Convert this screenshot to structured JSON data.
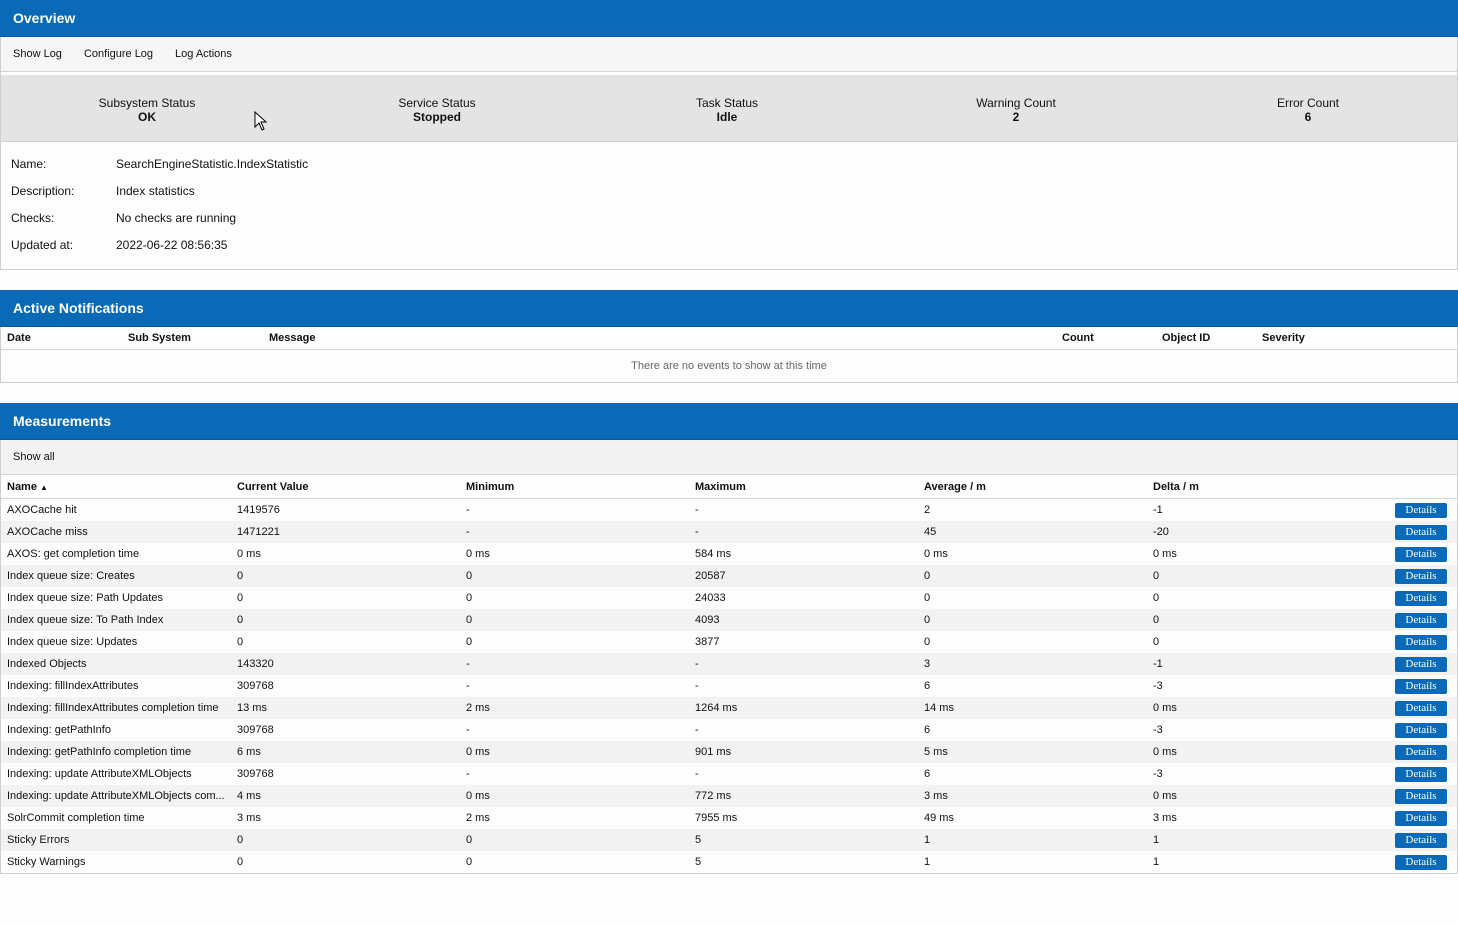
{
  "overview": {
    "title": "Overview",
    "toolbar": [
      "Show Log",
      "Configure Log",
      "Log Actions"
    ],
    "status": [
      {
        "label": "Subsystem Status",
        "value": "OK"
      },
      {
        "label": "Service Status",
        "value": "Stopped"
      },
      {
        "label": "Task Status",
        "value": "Idle"
      },
      {
        "label": "Warning Count",
        "value": "2"
      },
      {
        "label": "Error Count",
        "value": "6"
      }
    ],
    "info": [
      {
        "label": "Name:",
        "value": "SearchEngineStatistic.IndexStatistic"
      },
      {
        "label": "Description:",
        "value": "Index statistics"
      },
      {
        "label": "Checks:",
        "value": "No checks are running"
      },
      {
        "label": "Updated at:",
        "value": "2022-06-22 08:56:35"
      }
    ]
  },
  "notifications": {
    "title": "Active Notifications",
    "columns": [
      "Date",
      "Sub System",
      "Message",
      "Count",
      "Object ID",
      "Severity"
    ],
    "empty_text": "There are no events to show at this time"
  },
  "measurements": {
    "title": "Measurements",
    "show_all": "Show all",
    "columns": [
      "Name",
      "Current Value",
      "Minimum",
      "Maximum",
      "Average / m",
      "Delta / m"
    ],
    "sort_icon": "sort-up-icon",
    "details_label": "Details",
    "rows": [
      [
        "AXOCache hit",
        "1419576",
        "-",
        "-",
        "2",
        "-1"
      ],
      [
        "AXOCache miss",
        "1471221",
        "-",
        "-",
        "45",
        "-20"
      ],
      [
        "AXOS: get completion time",
        "0 ms",
        "0 ms",
        "584 ms",
        "0 ms",
        "0 ms"
      ],
      [
        "Index queue size: Creates",
        "0",
        "0",
        "20587",
        "0",
        "0"
      ],
      [
        "Index queue size: Path Updates",
        "0",
        "0",
        "24033",
        "0",
        "0"
      ],
      [
        "Index queue size: To Path Index",
        "0",
        "0",
        "4093",
        "0",
        "0"
      ],
      [
        "Index queue size: Updates",
        "0",
        "0",
        "3877",
        "0",
        "0"
      ],
      [
        "Indexed Objects",
        "143320",
        "-",
        "-",
        "3",
        "-1"
      ],
      [
        "Indexing: fillIndexAttributes",
        "309768",
        "-",
        "-",
        "6",
        "-3"
      ],
      [
        "Indexing: fillIndexAttributes completion time",
        "13 ms",
        "2 ms",
        "1264 ms",
        "14 ms",
        "0 ms"
      ],
      [
        "Indexing: getPathInfo",
        "309768",
        "-",
        "-",
        "6",
        "-3"
      ],
      [
        "Indexing: getPathInfo completion time",
        "6 ms",
        "0 ms",
        "901 ms",
        "5 ms",
        "0 ms"
      ],
      [
        "Indexing: update AttributeXMLObjects",
        "309768",
        "-",
        "-",
        "6",
        "-3"
      ],
      [
        "Indexing: update AttributeXMLObjects com...",
        "4 ms",
        "0 ms",
        "772 ms",
        "3 ms",
        "0 ms"
      ],
      [
        "SolrCommit completion time",
        "3 ms",
        "2 ms",
        "7955 ms",
        "49 ms",
        "3 ms"
      ],
      [
        "Sticky Errors",
        "0",
        "0",
        "5",
        "1",
        "1"
      ],
      [
        "Sticky Warnings",
        "0",
        "0",
        "5",
        "1",
        "1"
      ]
    ]
  },
  "colors": {
    "header": "#0a6ab8",
    "status_bg": "#e4e4e4",
    "row_alt": "#f2f2f2"
  }
}
